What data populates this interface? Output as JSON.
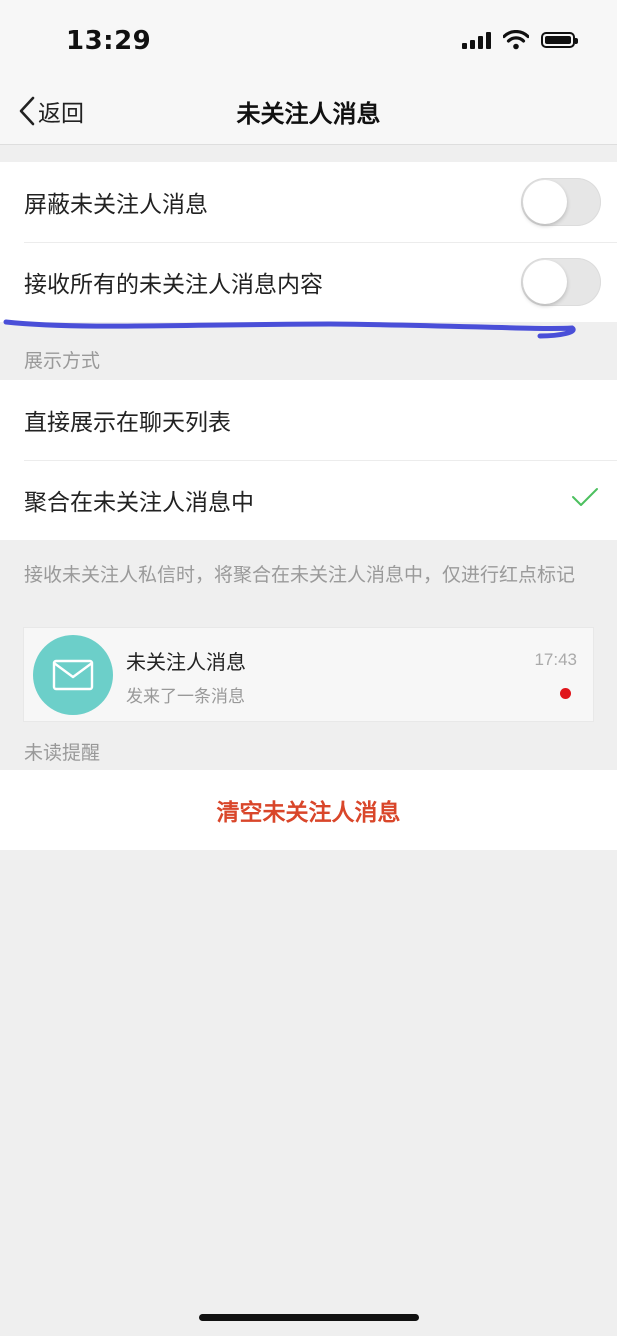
{
  "status_bar": {
    "time": "13:29"
  },
  "nav": {
    "back_label": "返回",
    "title": "未关注人消息"
  },
  "settings": {
    "block_label": "屏蔽未关注人消息",
    "block_enabled": false,
    "receive_all_label": "接收所有的未关注人消息内容",
    "receive_all_enabled": false
  },
  "display_section": {
    "header": "展示方式",
    "options": [
      {
        "label": "直接展示在聊天列表",
        "selected": false
      },
      {
        "label": "聚合在未关注人消息中",
        "selected": true
      }
    ],
    "note": "接收未关注人私信时，将聚合在未关注人消息中，仅进行红点标记"
  },
  "preview": {
    "name": "未关注人消息",
    "time": "17:43",
    "subtitle": "发来了一条消息",
    "avatar_color": "#6ccfc9",
    "unread_dot_color": "#e0151b"
  },
  "unread_section": {
    "header": "未读提醒"
  },
  "clear": {
    "label": "清空未关注人消息",
    "color": "#d9462a"
  },
  "colors": {
    "check": "#4cc05f",
    "annotation_stroke": "#4a4fd8"
  }
}
